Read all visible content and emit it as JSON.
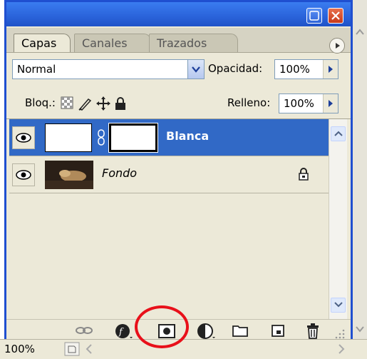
{
  "window": {
    "minimize_icon": "minimize-icon",
    "close_icon": "close-icon",
    "accent": "#2a63da",
    "close_color": "#c8391a"
  },
  "tabs": [
    {
      "label": "Capas",
      "active": true
    },
    {
      "label": "Canales",
      "active": false
    },
    {
      "label": "Trazados",
      "active": false
    }
  ],
  "blend_mode": {
    "value": "Normal"
  },
  "opacity": {
    "label": "Opacidad:",
    "value": "100%"
  },
  "lock": {
    "label": "Bloq.:"
  },
  "fill": {
    "label": "Relleno:",
    "value": "100%"
  },
  "layers": [
    {
      "name": "Blanca",
      "selected": true,
      "visible": true,
      "has_mask": true,
      "locked": false
    },
    {
      "name": "Fondo",
      "selected": false,
      "visible": true,
      "has_mask": false,
      "locked": true
    }
  ],
  "bottom_icons": [
    "link-layers-icon",
    "layer-style-icon",
    "add-mask-icon",
    "adjustment-layer-icon",
    "new-group-icon",
    "new-layer-icon",
    "trash-icon"
  ],
  "highlight_color": "#e8101a",
  "selection_color": "#3169c6",
  "status": {
    "zoom": "100%"
  }
}
